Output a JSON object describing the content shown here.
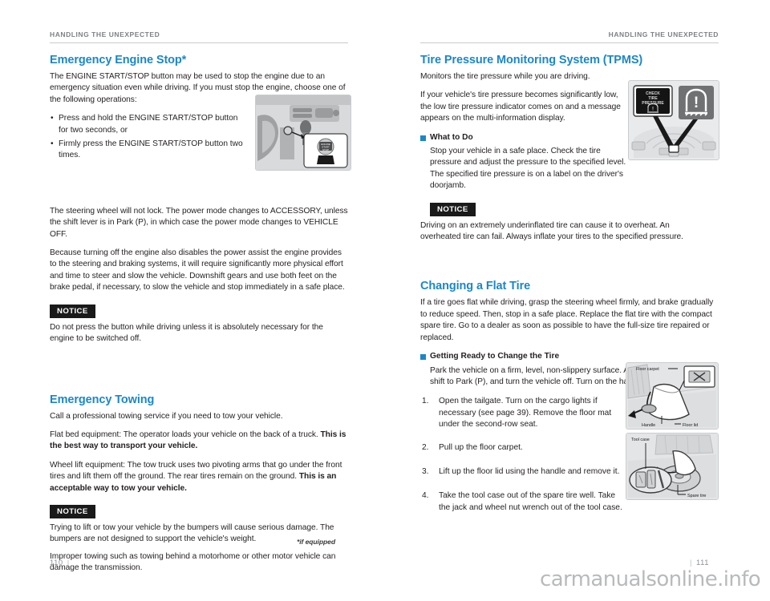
{
  "watermark": "carmanualsonline.info",
  "colors": {
    "heading_blue": "#1b87c9",
    "runhead_gray": "#7e8184",
    "notice_black": "#1a1a1a",
    "page_number_gray": "#8c9094"
  },
  "left_page": {
    "running_head": "HANDLING THE UNEXPECTED",
    "page_number": "110",
    "footnote": "*if equipped",
    "section1": {
      "heading": "Emergency Engine Stop*",
      "intro": "The ENGINE START/STOP button may be used to stop the engine due to an emergency situation even while driving. If you must stop the engine, choose one of the following operations:",
      "bullets": [
        "Press and hold the ENGINE START/STOP button for two seconds, or",
        "Firmly press the ENGINE START/STOP button two times."
      ],
      "para_after_bullets_1": "The steering wheel will not lock. The power mode changes to ACCESSORY, unless the shift lever is in Park (P), in which case the power mode changes to VEHICLE OFF.",
      "para_after_bullets_2": "Because turning off the engine also disables the power assist the engine provides to the steering and braking systems, it will require significantly more physical effort and time to steer and slow the vehicle. Downshift gears and use both feet on the brake pedal, if necessary, to slow the vehicle and stop immediately in a safe place.",
      "notice_label": "NOTICE",
      "notice_text": "Do not press the button while driving unless it is absolutely necessary for the engine to be switched off."
    },
    "section2": {
      "heading": "Emergency Towing",
      "para1": "Call a professional towing service if you need to tow your vehicle.",
      "para2_normal": "Flat bed equipment: The operator loads your vehicle on the back of a truck. ",
      "para2_bold": "This is the best way to transport your vehicle.",
      "para3_normal": "Wheel lift equipment: The tow truck uses two pivoting arms that go under the front tires and lift them off the ground. The rear tires remain on the ground. ",
      "para3_bold": "This is an acceptable way to tow your vehicle.",
      "notice_label": "NOTICE",
      "notice_text1": "Trying to lift or tow your vehicle by the bumpers will cause serious damage. The bumpers are not designed to support the vehicle's weight.",
      "notice_text2": "Improper towing such as towing behind a motorhome or other motor vehicle can damage the transmission."
    },
    "figure_engine": {
      "name": "engine-start-stop-photo",
      "callout_button_text_line1": "ENGINE",
      "callout_button_text_line2": "START",
      "callout_button_text_line3": "STOP"
    }
  },
  "right_page": {
    "running_head": "HANDLING THE UNEXPECTED",
    "page_number": "111",
    "section1": {
      "heading": "Tire Pressure Monitoring System (TPMS)",
      "para1": "Monitors the tire pressure while you are driving.",
      "para2": "If your vehicle's tire pressure becomes significantly low, the low tire pressure indicator comes on and a message appears on the multi-information display.",
      "subhead": "What to Do",
      "subhead_body": "Stop your vehicle in a safe place. Check the tire pressure and adjust the pressure to the specified level. The specified tire pressure is on a label on the driver's doorjamb.",
      "notice_label": "NOTICE",
      "notice_text": "Driving on an extremely underinflated tire can cause it to overheat. An overheated tire can fail. Always inflate your tires to the specified pressure."
    },
    "section2": {
      "heading": "Changing a Flat Tire",
      "para1": "If a tire goes flat while driving, grasp the steering wheel firmly, and brake gradually to reduce speed. Then, stop in a safe place. Replace the flat tire with the compact spare tire. Go to a dealer as soon as possible to have the full-size tire repaired or replaced.",
      "subhead": "Getting Ready to Change the Tire",
      "subhead_body": "Park the vehicle on a firm, level, non-slippery surface. Apply the parking brake, shift to Park (P), and turn the vehicle off. Turn on the hazard warning lights.",
      "steps": [
        {
          "num": "1.",
          "text": "Open the tailgate. Turn on the cargo lights if necessary (see page 39). Remove the floor mat under the second-row seat."
        },
        {
          "num": "2.",
          "text": "Pull up the floor carpet."
        },
        {
          "num": "3.",
          "text": "Lift up the floor lid using the handle and remove it."
        },
        {
          "num": "4.",
          "text": "Take the tool case out of the spare tire well. Take the jack and wheel nut wrench out of the tool case."
        }
      ]
    },
    "figure_tpms": {
      "name": "tpms-indicator-illustration",
      "display_line1": "CHECK",
      "display_line2": "TIRE",
      "display_line3": "PRESSURE"
    },
    "figure_floor": {
      "name": "floor-carpet-illustration",
      "label_top": "Floor carpet",
      "label_bottom_left": "Handle",
      "label_bottom_right": "Floor lid"
    },
    "figure_toolcase": {
      "name": "tool-case-illustration",
      "label_top": "Tool case",
      "label_bottom": "Spare tire"
    }
  }
}
